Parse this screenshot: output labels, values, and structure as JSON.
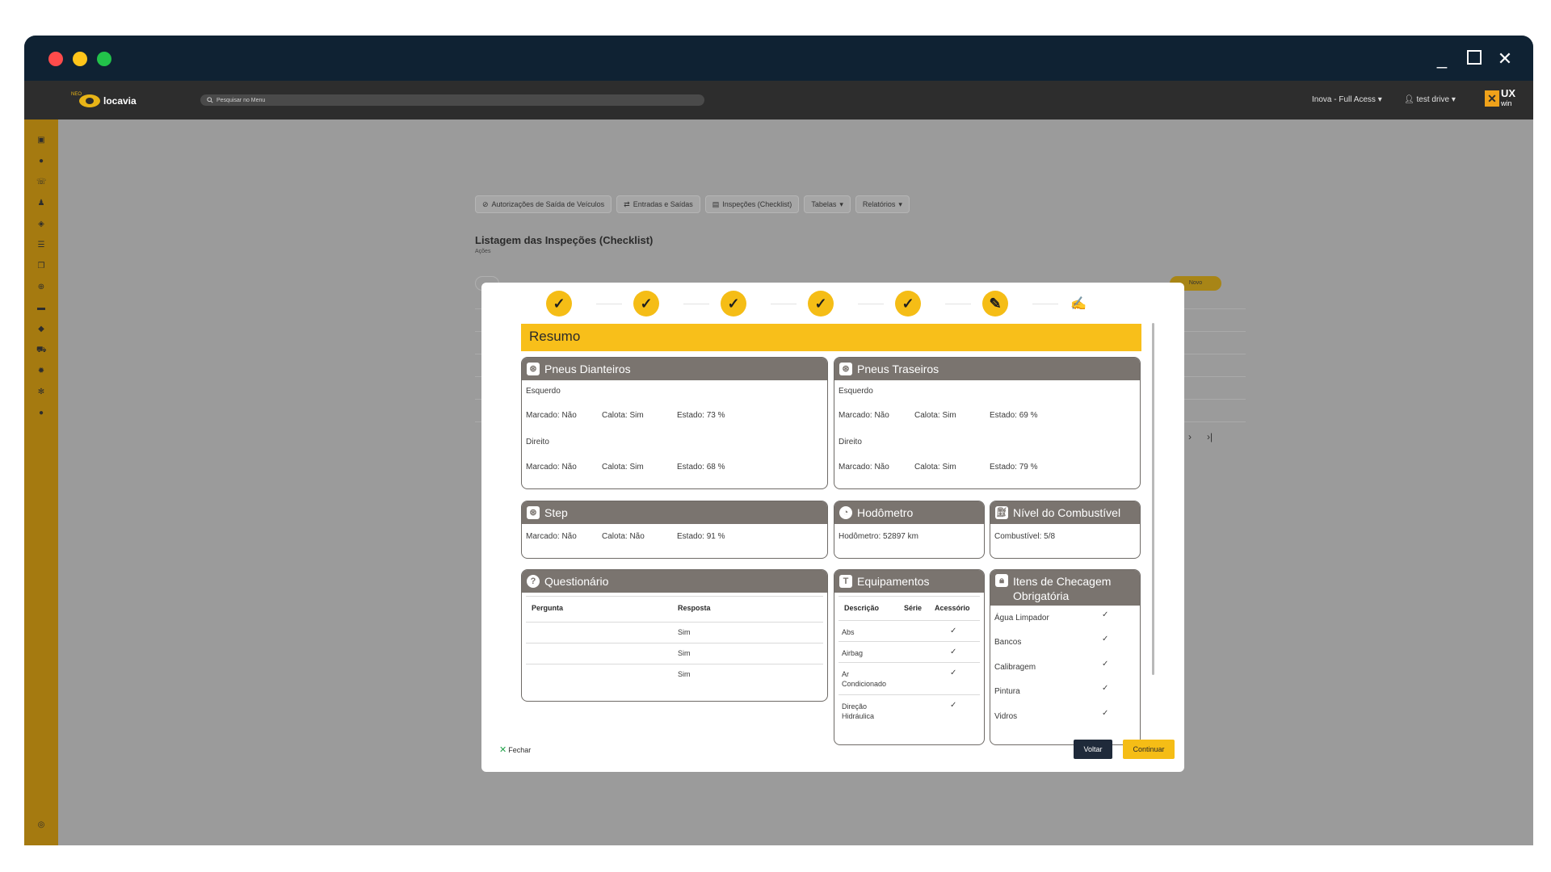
{
  "app": {
    "brand": "locavia",
    "brand_sub": "NEO",
    "search_placeholder": "Pesquisar no Menu",
    "profile": "Inova - Full Acess",
    "user": "test drive",
    "vendor_top": "UX",
    "vendor_bottom": "win"
  },
  "topnav": [
    {
      "label": "Autorizações de Saída de Veículos",
      "icon": "check-circle-icon"
    },
    {
      "label": "Entradas e Saídas",
      "icon": "arrows-icon"
    },
    {
      "label": "Inspeções (Checklist)",
      "icon": "clipboard-icon"
    },
    {
      "label": "Tabelas",
      "icon": "chevron-down-icon"
    },
    {
      "label": "Relatórios",
      "icon": "chevron-down-icon"
    }
  ],
  "page": {
    "title": "Listagem das Inspeções (Checklist)",
    "subtitle": "Ações",
    "novo": "Novo"
  },
  "modal": {
    "steps_done": 5,
    "current_step": 6,
    "total_steps": 7,
    "resumo_title": "Resumo",
    "close_label": "Fechar",
    "back_label": "Voltar",
    "continue_label": "Continuar",
    "pneus_dianteiros": {
      "title": "Pneus Dianteiros",
      "left_label": "Esquerdo",
      "left": {
        "marcado": "Marcado: Não",
        "calota": "Calota: Sim",
        "estado": "Estado: 73 %"
      },
      "right_label": "Direito",
      "right": {
        "marcado": "Marcado: Não",
        "calota": "Calota: Sim",
        "estado": "Estado: 68 %"
      }
    },
    "pneus_traseiros": {
      "title": "Pneus Traseiros",
      "left_label": "Esquerdo",
      "left": {
        "marcado": "Marcado: Não",
        "calota": "Calota: Sim",
        "estado": "Estado: 69 %"
      },
      "right_label": "Direito",
      "right": {
        "marcado": "Marcado: Não",
        "calota": "Calota: Sim",
        "estado": "Estado: 79 %"
      }
    },
    "step": {
      "title": "Step",
      "marcado": "Marcado: Não",
      "calota": "Calota: Não",
      "estado": "Estado: 91 %"
    },
    "hodometro": {
      "title": "Hodômetro",
      "value": "Hodômetro: 52897 km"
    },
    "combustivel": {
      "title": "Nível do Combustível",
      "value": "Combustível: 5/8"
    },
    "questionario": {
      "title": "Questionário",
      "col_pergunta": "Pergunta",
      "col_resposta": "Resposta",
      "rows": [
        "Sim",
        "Sim",
        "Sim"
      ]
    },
    "equipamentos": {
      "title": "Equipamentos",
      "col_descricao": "Descrição",
      "col_serie": "Série",
      "col_acessorio": "Acessório",
      "rows": [
        {
          "l1": "Abs",
          "l2": ""
        },
        {
          "l1": "Airbag",
          "l2": ""
        },
        {
          "l1": "Ar",
          "l2": "Condicionado"
        },
        {
          "l1": "Direção",
          "l2": "Hidráulica"
        }
      ]
    },
    "checagem": {
      "title_l1": "Itens de Checagem",
      "title_l2": "Obrigatória",
      "items": [
        "Água Limpador",
        "Bancos",
        "Calibragem",
        "Pintura",
        "Vidros"
      ]
    }
  }
}
